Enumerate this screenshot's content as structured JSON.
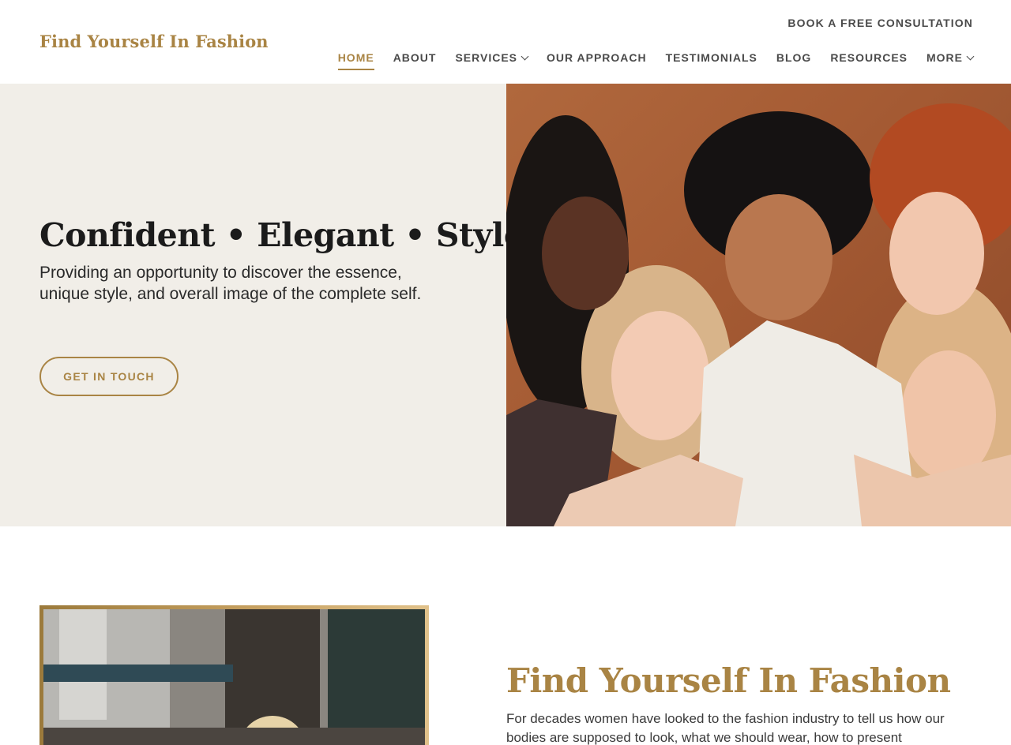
{
  "brand": {
    "name": "Find Yourself In Fashion",
    "color": "#a98444"
  },
  "header": {
    "cta": "BOOK A FREE CONSULTATION",
    "nav": [
      {
        "label": "HOME",
        "active": true,
        "dropdown": false
      },
      {
        "label": "ABOUT",
        "active": false,
        "dropdown": false
      },
      {
        "label": "SERVICES",
        "active": false,
        "dropdown": true
      },
      {
        "label": "OUR APPROACH",
        "active": false,
        "dropdown": false
      },
      {
        "label": "TESTIMONIALS",
        "active": false,
        "dropdown": false
      },
      {
        "label": "BLOG",
        "active": false,
        "dropdown": false
      },
      {
        "label": "RESOURCES",
        "active": false,
        "dropdown": false
      },
      {
        "label": "MORE",
        "active": false,
        "dropdown": true
      }
    ]
  },
  "hero": {
    "title": "Confident • Elegant • Style",
    "subtitle": "Providing an opportunity to discover the essence, unique style, and overall image of the complete self.",
    "button": "GET IN TOUCH",
    "background": "#f1eee8"
  },
  "section2": {
    "title": "Find Yourself In Fashion",
    "body": "For decades women have looked to the fashion industry to tell us how our bodies are supposed to look, what we should wear, how to present"
  }
}
